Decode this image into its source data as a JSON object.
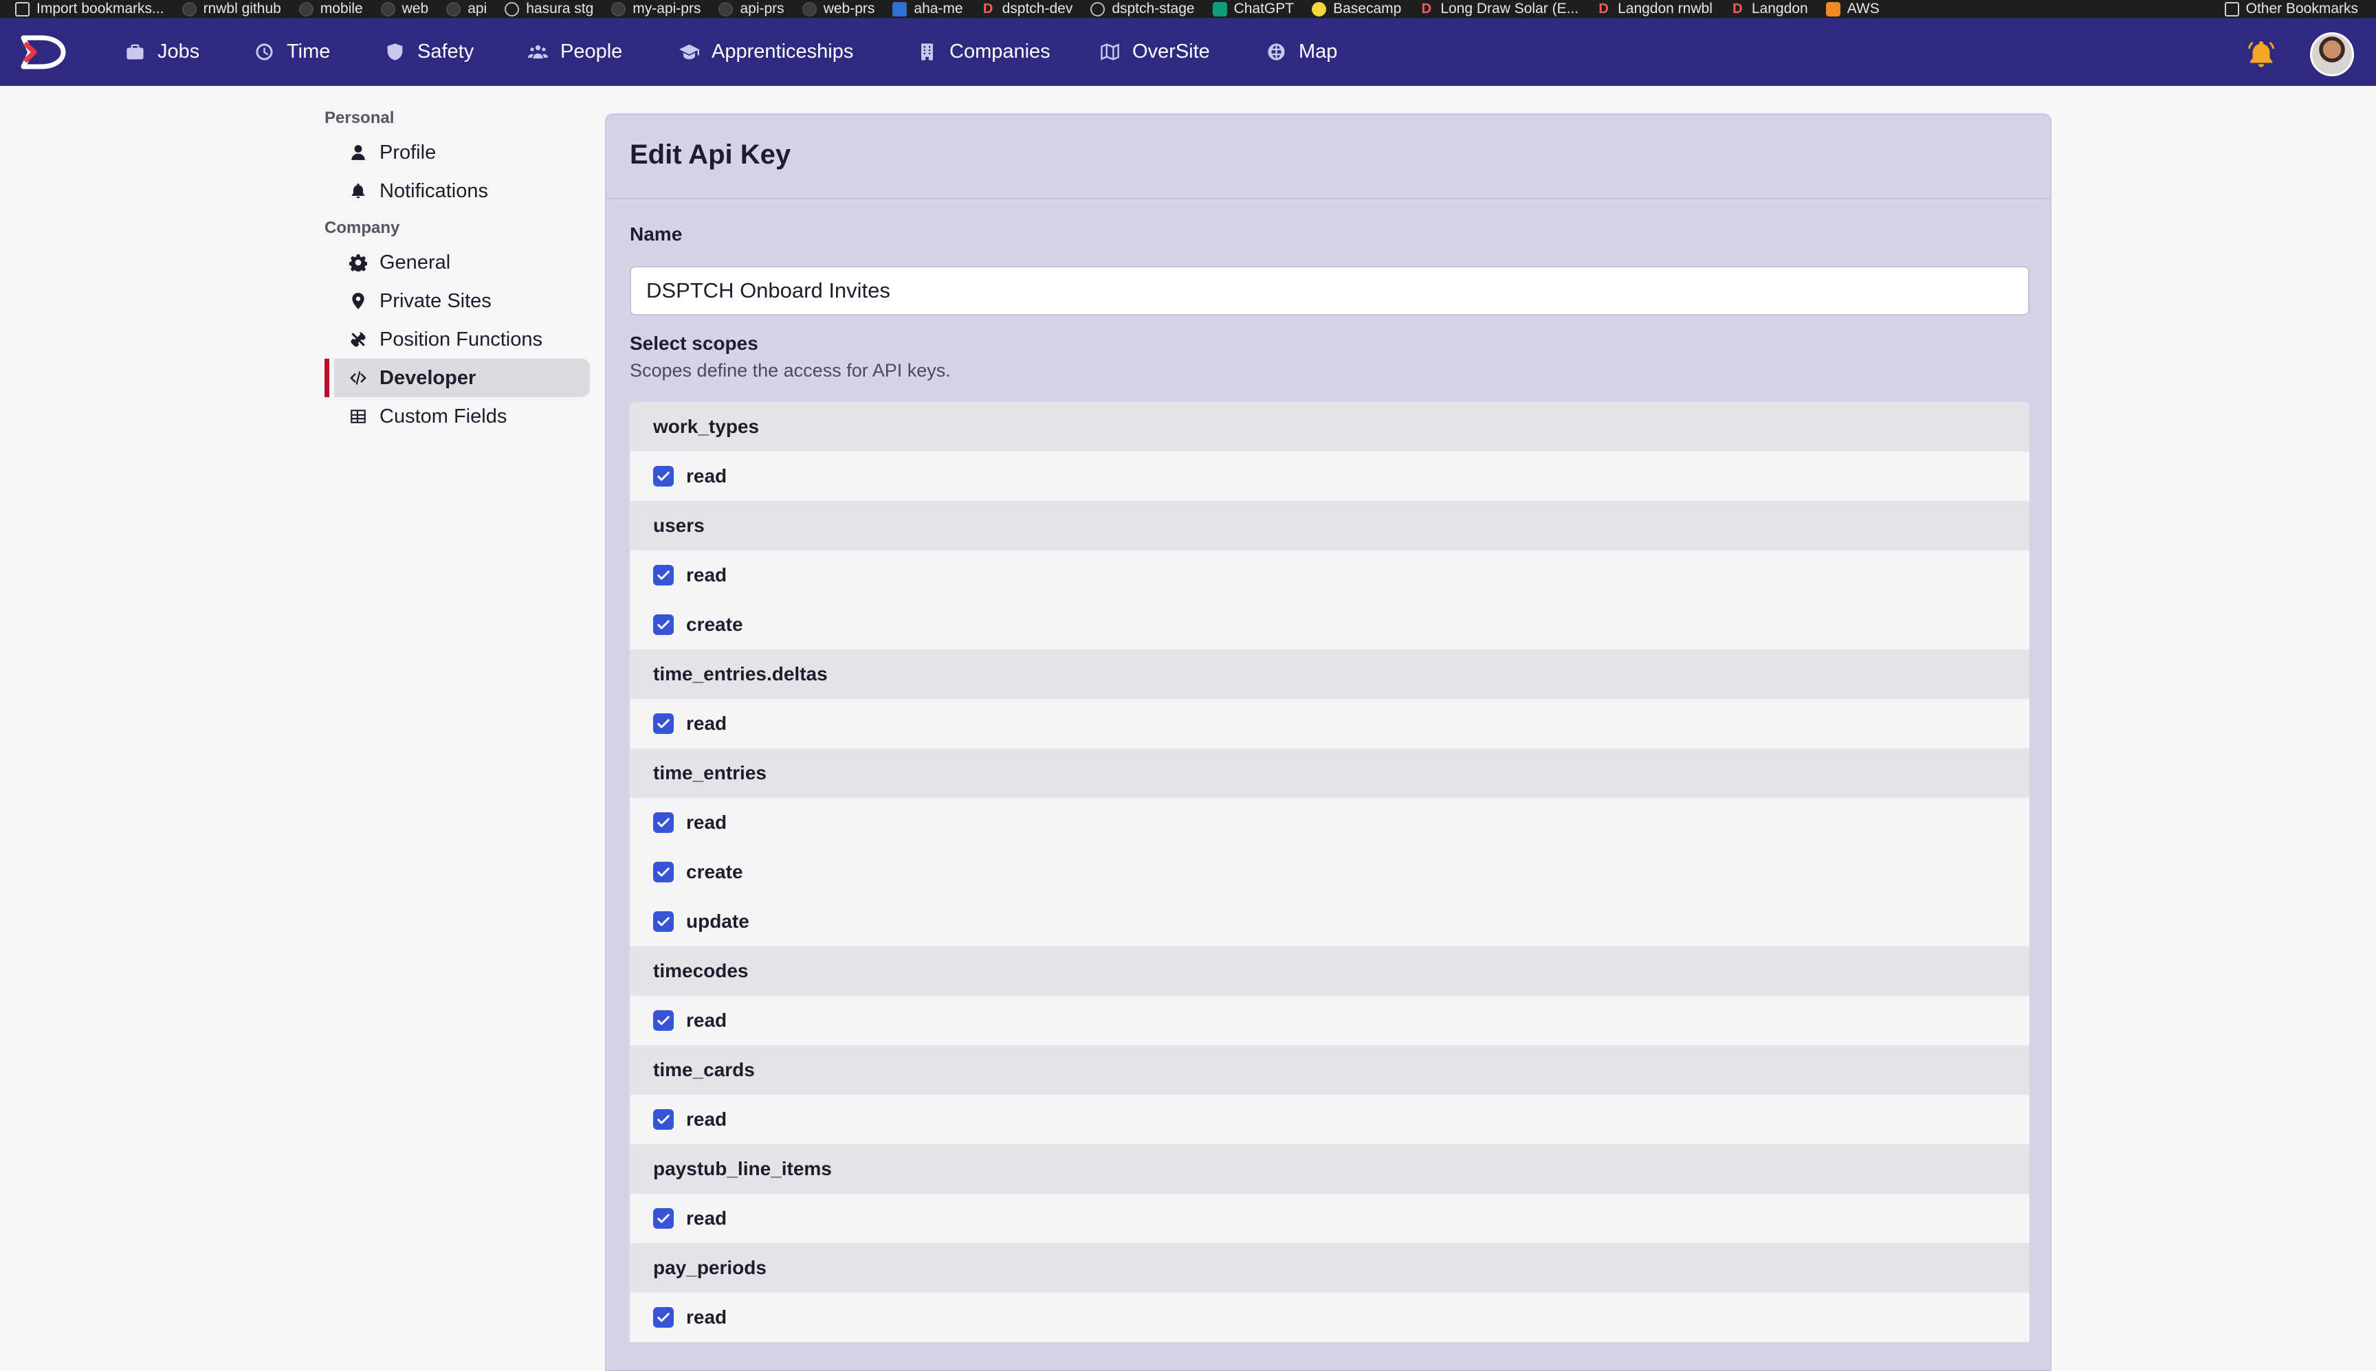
{
  "bookmarks": {
    "items": [
      {
        "label": "Import bookmarks...",
        "icon": "import-icon"
      },
      {
        "label": "rnwbl github",
        "icon": "github-icon"
      },
      {
        "label": "mobile",
        "icon": "github-icon"
      },
      {
        "label": "web",
        "icon": "github-icon"
      },
      {
        "label": "api",
        "icon": "github-icon"
      },
      {
        "label": "hasura stg",
        "icon": "globe-icon"
      },
      {
        "label": "my-api-prs",
        "icon": "github-icon"
      },
      {
        "label": "api-prs",
        "icon": "github-icon"
      },
      {
        "label": "web-prs",
        "icon": "github-icon"
      },
      {
        "label": "aha-me",
        "icon": "aha-icon"
      },
      {
        "label": "dsptch-dev",
        "icon": "dsptch-icon"
      },
      {
        "label": "dsptch-stage",
        "icon": "globe-icon"
      },
      {
        "label": "ChatGPT",
        "icon": "chatgpt-icon"
      },
      {
        "label": "Basecamp",
        "icon": "basecamp-icon"
      },
      {
        "label": "Long Draw Solar (E...",
        "icon": "dsptch-icon"
      },
      {
        "label": "Langdon rnwbl",
        "icon": "dsptch-icon"
      },
      {
        "label": "Langdon",
        "icon": "dsptch-icon"
      },
      {
        "label": "AWS",
        "icon": "aws-icon"
      }
    ],
    "other": "Other Bookmarks"
  },
  "nav": {
    "items": [
      {
        "label": "Jobs",
        "icon": "briefcase-icon"
      },
      {
        "label": "Time",
        "icon": "clock-icon"
      },
      {
        "label": "Safety",
        "icon": "shield-icon"
      },
      {
        "label": "People",
        "icon": "people-icon"
      },
      {
        "label": "Apprenticeships",
        "icon": "graduation-cap-icon"
      },
      {
        "label": "Companies",
        "icon": "building-icon"
      },
      {
        "label": "OverSite",
        "icon": "map-book-icon"
      },
      {
        "label": "Map",
        "icon": "globe-icon"
      }
    ],
    "bell_color": "#f5a623",
    "brand_color": "#2e2a80"
  },
  "sidebar": {
    "personal_label": "Personal",
    "personal": [
      {
        "label": "Profile",
        "icon": "user-icon"
      },
      {
        "label": "Notifications",
        "icon": "bell-icon"
      }
    ],
    "company_label": "Company",
    "company": [
      {
        "label": "General",
        "icon": "gear-icon"
      },
      {
        "label": "Private Sites",
        "icon": "location-pin-icon"
      },
      {
        "label": "Position Functions",
        "icon": "tools-icon"
      },
      {
        "label": "Developer",
        "icon": "code-icon",
        "active": true
      },
      {
        "label": "Custom Fields",
        "icon": "table-icon"
      }
    ],
    "active_color": "#b3132b"
  },
  "form": {
    "title": "Edit Api Key",
    "name_label": "Name",
    "name_value": "DSPTCH Onboard Invites",
    "scopes_label": "Select scopes",
    "scopes_description": "Scopes define the access for API keys.",
    "checkbox_color": "#3754d6",
    "scopes": [
      {
        "name": "work_types",
        "permissions": [
          {
            "label": "read",
            "checked": true
          }
        ]
      },
      {
        "name": "users",
        "permissions": [
          {
            "label": "read",
            "checked": true
          },
          {
            "label": "create",
            "checked": true
          }
        ]
      },
      {
        "name": "time_entries.deltas",
        "permissions": [
          {
            "label": "read",
            "checked": true
          }
        ]
      },
      {
        "name": "time_entries",
        "permissions": [
          {
            "label": "read",
            "checked": true
          },
          {
            "label": "create",
            "checked": true
          },
          {
            "label": "update",
            "checked": true
          }
        ]
      },
      {
        "name": "timecodes",
        "permissions": [
          {
            "label": "read",
            "checked": true
          }
        ]
      },
      {
        "name": "time_cards",
        "permissions": [
          {
            "label": "read",
            "checked": true
          }
        ]
      },
      {
        "name": "paystub_line_items",
        "permissions": [
          {
            "label": "read",
            "checked": true
          }
        ]
      },
      {
        "name": "pay_periods",
        "permissions": [
          {
            "label": "read",
            "checked": true
          }
        ]
      }
    ]
  }
}
